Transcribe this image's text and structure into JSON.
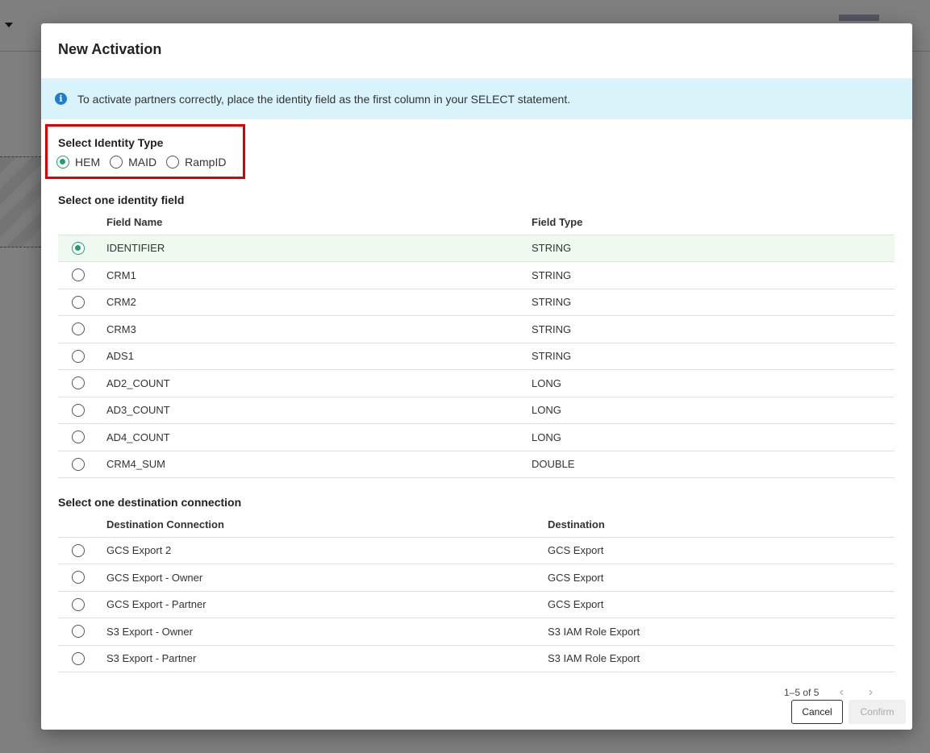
{
  "modal": {
    "title": "New Activation",
    "info_banner": "To activate partners correctly, place the identity field as the first column in your SELECT statement."
  },
  "identity_type": {
    "title": "Select Identity Type",
    "options": [
      {
        "label": "HEM",
        "checked": true
      },
      {
        "label": "MAID",
        "checked": false
      },
      {
        "label": "RampID",
        "checked": false
      }
    ]
  },
  "identity_field": {
    "title": "Select one identity field",
    "columns": [
      "Field Name",
      "Field Type"
    ],
    "rows": [
      {
        "name": "IDENTIFIER",
        "type": "STRING",
        "selected": true
      },
      {
        "name": "CRM1",
        "type": "STRING",
        "selected": false
      },
      {
        "name": "CRM2",
        "type": "STRING",
        "selected": false
      },
      {
        "name": "CRM3",
        "type": "STRING",
        "selected": false
      },
      {
        "name": "ADS1",
        "type": "STRING",
        "selected": false
      },
      {
        "name": "AD2_COUNT",
        "type": "LONG",
        "selected": false
      },
      {
        "name": "AD3_COUNT",
        "type": "LONG",
        "selected": false
      },
      {
        "name": "AD4_COUNT",
        "type": "LONG",
        "selected": false
      },
      {
        "name": "CRM4_SUM",
        "type": "DOUBLE",
        "selected": false
      }
    ]
  },
  "destination": {
    "title": "Select one destination connection",
    "columns": [
      "Destination Connection",
      "Destination"
    ],
    "rows": [
      {
        "connection": "GCS Export 2",
        "destination": "GCS Export"
      },
      {
        "connection": "GCS Export - Owner",
        "destination": "GCS Export"
      },
      {
        "connection": "GCS Export - Partner",
        "destination": "GCS Export"
      },
      {
        "connection": "S3 Export - Owner",
        "destination": "S3 IAM Role Export"
      },
      {
        "connection": "S3 Export - Partner",
        "destination": "S3 IAM Role Export"
      }
    ],
    "pagination": "1–5 of 5"
  },
  "footer": {
    "cancel": "Cancel",
    "confirm": "Confirm"
  },
  "icons": {
    "info": "i",
    "prev": "‹",
    "next": "›"
  },
  "colors": {
    "accent": "#1f9e6e",
    "info_bg": "#d8f3fa",
    "highlight_border": "#e00000"
  }
}
